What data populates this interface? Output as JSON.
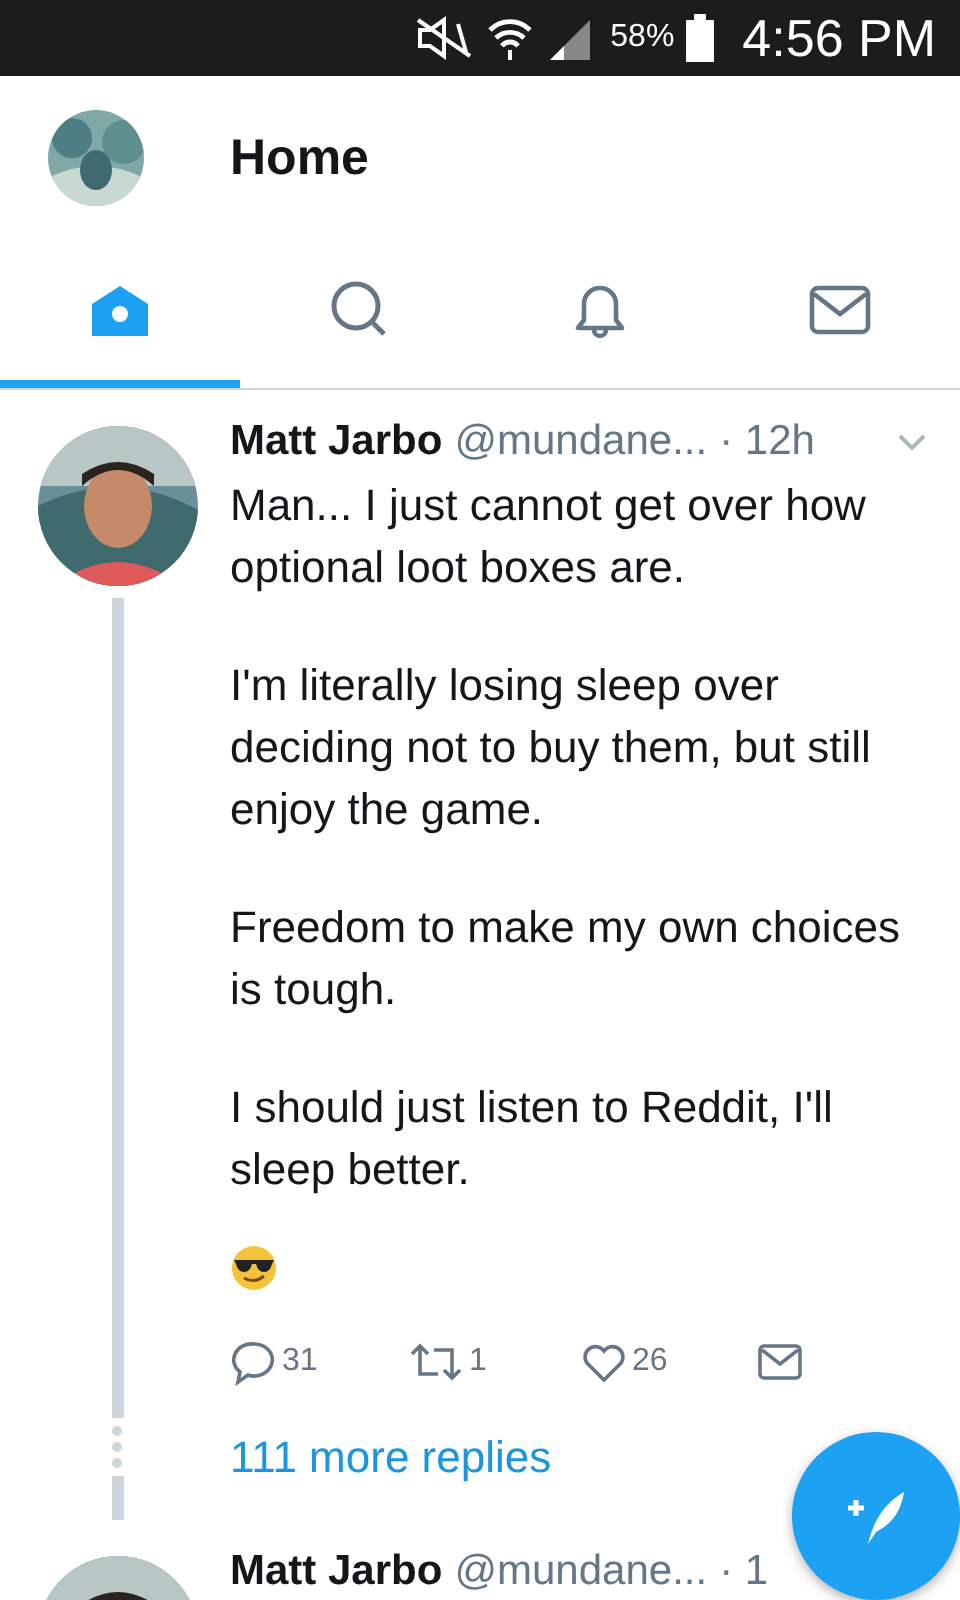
{
  "status_bar": {
    "battery": "58%",
    "time": "4:56 PM"
  },
  "header": {
    "title": "Home"
  },
  "tabs": [
    {
      "kind": "home",
      "selected": true
    },
    {
      "kind": "search",
      "selected": false
    },
    {
      "kind": "notifications",
      "selected": false
    },
    {
      "kind": "messages",
      "selected": false
    }
  ],
  "tweets": [
    {
      "name": "Matt Jarbo",
      "handle": "@mundane...",
      "time": "· 12h",
      "paragraphs": [
        "Man... I just cannot get over how optional loot boxes are.",
        "I'm literally losing sleep over deciding not to buy them, but still enjoy the game.",
        "Freedom to make my own choices is tough.",
        "I should just listen to Reddit, I'll sleep better."
      ],
      "emoji": true,
      "replies": "31",
      "retweets": "1",
      "likes": "26",
      "more_replies": "111 more replies"
    },
    {
      "name": "Matt Jarbo",
      "handle": "@mundane...",
      "time": "· 1"
    }
  ]
}
